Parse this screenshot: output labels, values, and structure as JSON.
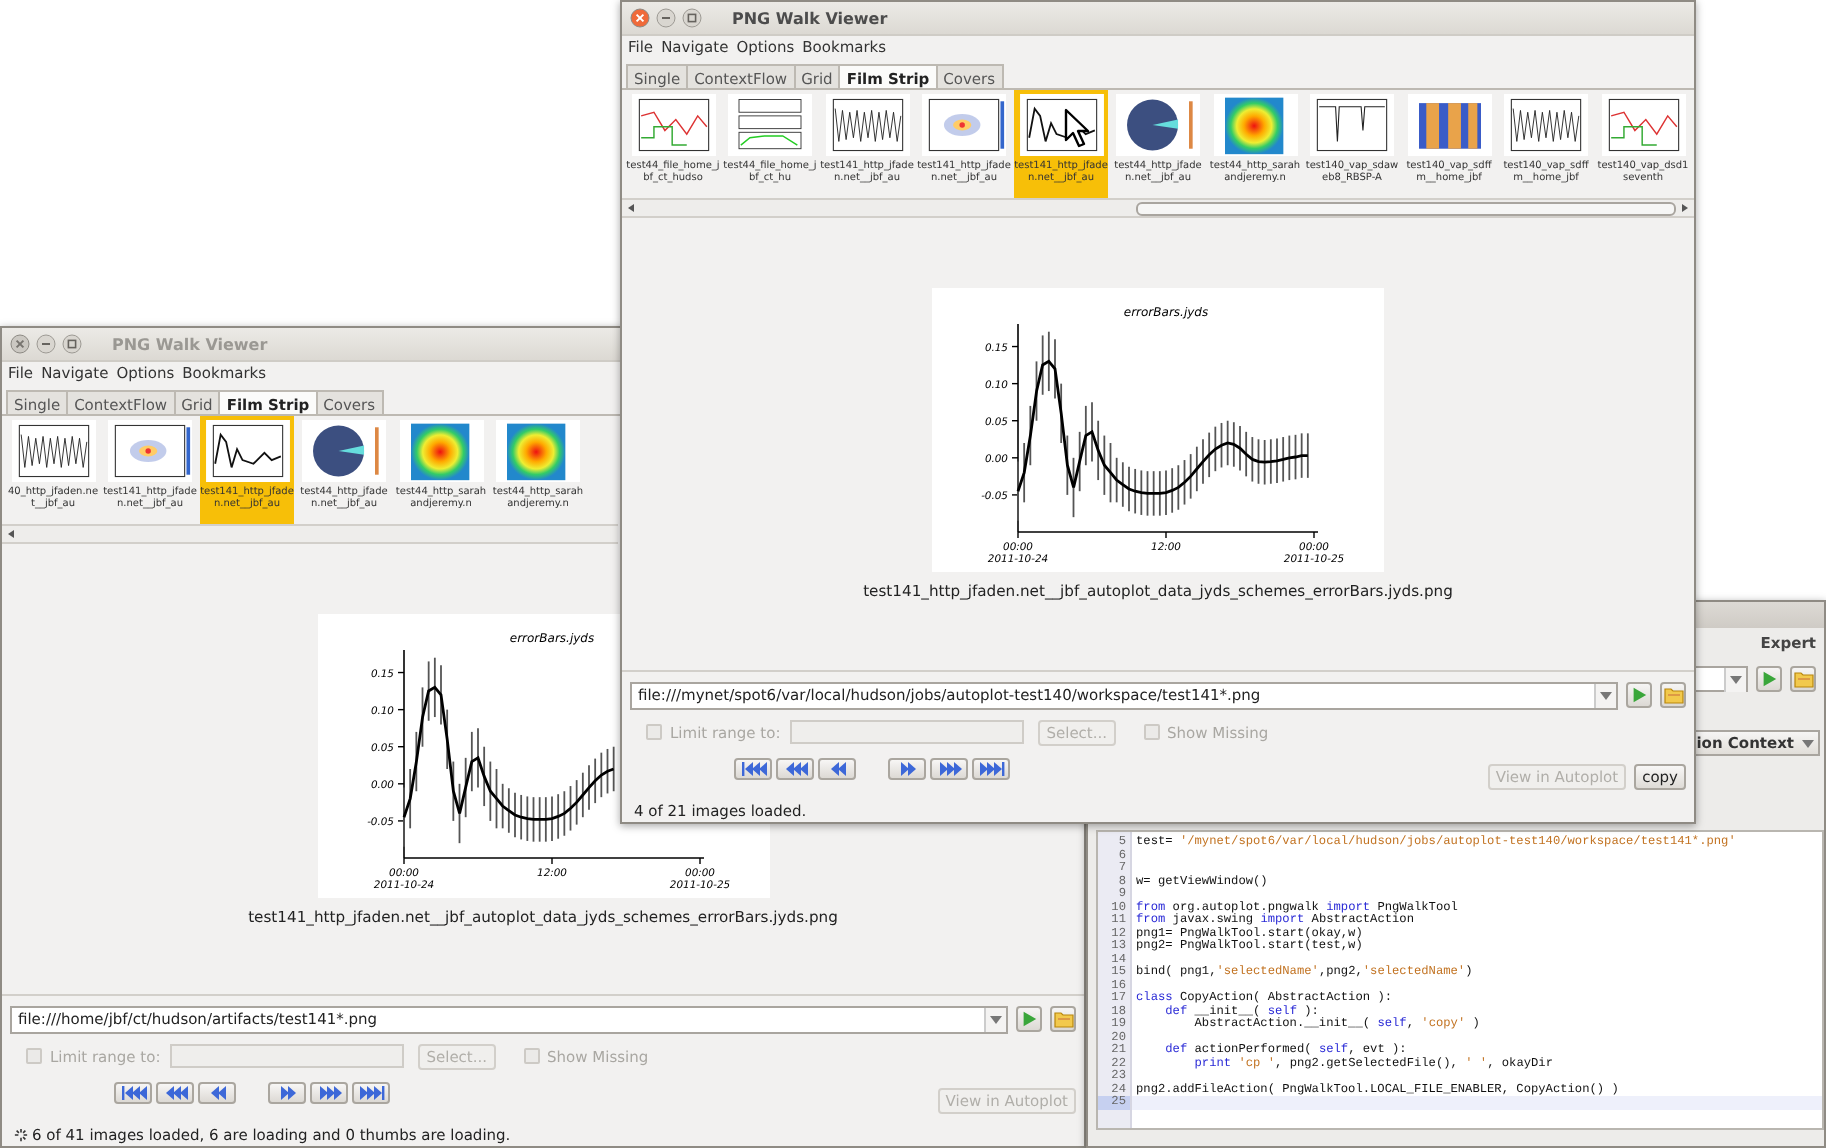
{
  "windows": [
    {
      "kind": "pngwalk",
      "active": true,
      "busy": false,
      "title": "PNG Walk Viewer",
      "menu": [
        "File",
        "Navigate",
        "Options",
        "Bookmarks"
      ],
      "tabs": [
        {
          "label": "Single",
          "selected": false
        },
        {
          "label": "ContextFlow",
          "selected": false
        },
        {
          "label": "Grid",
          "selected": false
        },
        {
          "label": "Film Strip",
          "selected": true
        },
        {
          "label": "Covers",
          "selected": false
        }
      ],
      "thumbnails": [
        {
          "kind": "lineplot",
          "caption": "test44_file_home_jbf_ct_hudso",
          "selected": false
        },
        {
          "kind": "stacked",
          "caption": "test44_file_home_jbf_ct_hu",
          "selected": false
        },
        {
          "kind": "dense",
          "caption": "test141_http_jfaden.net__jbf_au",
          "selected": false
        },
        {
          "kind": "scatter",
          "caption": "test141_http_jfaden.net__jbf_au",
          "selected": false
        },
        {
          "kind": "errorbars",
          "caption": "test141_http_jfaden.net__jbf_au",
          "selected": true
        },
        {
          "kind": "pie",
          "caption": "test44_http_jfaden.net__jbf_au",
          "selected": false
        },
        {
          "kind": "heatmap",
          "caption": "test44_http_sarahandjeremy.n",
          "selected": false
        },
        {
          "kind": "spikes",
          "caption": "test140_vap_sdaweb8_RBSP-A",
          "selected": false
        },
        {
          "kind": "spectrogram",
          "caption": "test140_vap_sdffm__home_jbf",
          "selected": false
        },
        {
          "kind": "dense",
          "caption": "test140_vap_sdffm__home_jbf",
          "selected": false
        },
        {
          "kind": "lineplot",
          "caption": "test140_vap_dsd1seventh",
          "selected": false
        }
      ],
      "preview": {
        "caption": "test141_http_jfaden.net__jbf_autoplot_data_jyds_schemes_errorBars.jyds.png",
        "date_labels": [
          {
            "text": "2011-10-24",
            "kind": "start"
          },
          {
            "text": "2011-10-25",
            "kind": "end"
          }
        ],
        "chart_data": {
          "type": "line",
          "title": "errorBars.jyds",
          "categories": [
            "00:00",
            null,
            null,
            null,
            null,
            null,
            null,
            null,
            null,
            null,
            null,
            null,
            null,
            null,
            null,
            null,
            null,
            null,
            null,
            null,
            null,
            null,
            null,
            null,
            "12:00",
            null,
            null,
            null,
            null,
            null,
            null,
            null,
            null,
            null,
            null,
            null,
            null,
            null,
            null,
            null,
            null,
            null,
            null,
            null,
            null,
            null,
            null,
            null,
            "00:00"
          ],
          "series": [
            {
              "color": "#000000",
              "values": [
                -0.045,
                -0.02,
                0.03,
                0.09,
                0.125,
                0.13,
                0.12,
                0.06,
                -0.01,
                -0.04,
                -0.005,
                0.03,
                0.035,
                0.01,
                -0.01,
                -0.02,
                -0.03,
                -0.036,
                -0.042,
                -0.045,
                -0.047,
                -0.048,
                -0.048,
                -0.048,
                -0.047,
                -0.044,
                -0.04,
                -0.033,
                -0.025,
                -0.015,
                -0.005,
                0.004,
                0.012,
                0.017,
                0.02,
                0.018,
                0.013,
                0.005,
                -0.002,
                -0.005,
                -0.006,
                -0.005,
                -0.004,
                -0.002,
                0.0,
                0.001,
                0.003,
                0.003,
                null
              ]
            }
          ],
          "ylim": [
            -0.1,
            0.175
          ],
          "yticks": [
            {
              "value": -0.05,
              "label": "-0.05"
            },
            {
              "value": 0,
              "label": "0.00"
            },
            {
              "value": 0.05,
              "label": "0.05"
            },
            {
              "value": 0.1,
              "label": "0.10"
            },
            {
              "value": 0.15,
              "label": "0.15"
            }
          ]
        }
      },
      "url": "file:///mynet/spot6/var/local/hudson/jobs/autoplot-test140/workspace/test141*.png",
      "limit_range": {
        "label": "Limit range to:",
        "checked": false,
        "disabled": true
      },
      "select_button": {
        "label": "Select...",
        "disabled": true
      },
      "show_missing": {
        "label": "Show Missing",
        "checked": false,
        "disabled": true
      },
      "nav_buttons": [
        {
          "kind": "first"
        },
        {
          "kind": "prev_page"
        },
        {
          "kind": "prev"
        },
        {
          "kind": "next"
        },
        {
          "kind": "next_page"
        },
        {
          "kind": "last"
        }
      ],
      "actions": [
        {
          "label": "View in Autoplot",
          "disabled": true
        },
        {
          "label": "copy",
          "disabled": false
        }
      ],
      "status": "4 of 21 images loaded."
    },
    {
      "kind": "pngwalk",
      "active": false,
      "busy": true,
      "title": "PNG Walk Viewer",
      "menu": [
        "File",
        "Navigate",
        "Options",
        "Bookmarks"
      ],
      "tabs": [
        {
          "label": "Single",
          "selected": false
        },
        {
          "label": "ContextFlow",
          "selected": false
        },
        {
          "label": "Grid",
          "selected": false
        },
        {
          "label": "Film Strip",
          "selected": true
        },
        {
          "label": "Covers",
          "selected": false
        }
      ],
      "thumbnails": [
        {
          "kind": "dense",
          "caption": "40_http_jfaden.net__jbf_au",
          "selected": false
        },
        {
          "kind": "scatter",
          "caption": "test141_http_jfaden.net__jbf_au",
          "selected": false
        },
        {
          "kind": "errorbars",
          "caption": "test141_http_jfaden.net__jbf_au",
          "selected": true
        },
        {
          "kind": "pie",
          "caption": "test44_http_jfaden.net__jbf_au",
          "selected": false
        },
        {
          "kind": "heatmap",
          "caption": "test44_http_sarahandjeremy.n",
          "selected": false
        },
        {
          "kind": "heatmap",
          "caption": "test44_http_sarahandjeremy.n",
          "selected": false
        }
      ],
      "preview": {
        "caption": "test141_http_jfaden.net__jbf_autoplot_data_jyds_schemes_errorBars.jyds.png",
        "date_labels": [
          {
            "text": "2011-10-24",
            "kind": "start"
          },
          {
            "text": "2011-10-25",
            "kind": "end"
          }
        ],
        "chart_data": {
          "type": "line",
          "title": "errorBars.jyds",
          "categories": [
            "00:00",
            null,
            null,
            null,
            null,
            null,
            null,
            null,
            null,
            null,
            null,
            null,
            null,
            null,
            null,
            null,
            null,
            null,
            null,
            null,
            null,
            null,
            null,
            null,
            "12:00",
            null,
            null,
            null,
            null,
            null,
            null,
            null,
            null,
            null,
            null,
            null,
            null,
            null,
            null,
            null,
            null,
            null,
            null,
            null,
            null,
            null,
            null,
            null,
            "00:00"
          ],
          "series": [
            {
              "color": "#000000",
              "values": [
                -0.045,
                -0.02,
                0.03,
                0.09,
                0.125,
                0.13,
                0.12,
                0.06,
                -0.01,
                -0.04,
                -0.005,
                0.03,
                0.035,
                0.01,
                -0.01,
                -0.02,
                -0.03,
                -0.036,
                -0.042,
                -0.045,
                -0.047,
                -0.048,
                -0.048,
                -0.048,
                -0.047,
                -0.044,
                -0.04,
                -0.033,
                -0.025,
                -0.015,
                -0.005,
                0.004,
                0.012,
                0.017,
                0.02,
                null,
                null,
                null,
                null,
                null,
                null,
                null,
                null,
                null,
                null,
                null,
                null,
                null,
                null
              ]
            }
          ],
          "ylim": [
            -0.1,
            0.175
          ],
          "yticks": [
            {
              "value": -0.05,
              "label": "-0.05"
            },
            {
              "value": 0,
              "label": "0.00"
            },
            {
              "value": 0.05,
              "label": "0.05"
            },
            {
              "value": 0.1,
              "label": "0.10"
            },
            {
              "value": 0.15,
              "label": "0.15"
            }
          ]
        }
      },
      "url": "file:///home/jbf/ct/hudson/artifacts/test141*.png",
      "limit_range": {
        "label": "Limit range to:",
        "checked": false,
        "disabled": true
      },
      "select_button": {
        "label": "Select...",
        "disabled": true
      },
      "show_missing": {
        "label": "Show Missing",
        "checked": false,
        "disabled": true
      },
      "nav_buttons": [
        {
          "kind": "first"
        },
        {
          "kind": "prev_page"
        },
        {
          "kind": "prev"
        },
        {
          "kind": "next"
        },
        {
          "kind": "next_page"
        },
        {
          "kind": "last"
        }
      ],
      "actions": [
        {
          "label": "View in Autoplot",
          "disabled": true
        }
      ],
      "status": "6 of 41 images loaded, 6 are loading and 0 thumbs are loading."
    },
    {
      "kind": "editor",
      "menu_item": "Expert",
      "context_dropdown": "ion Context",
      "code_lines": [
        {
          "number": "5",
          "current": false,
          "segments": [
            {
              "kind": "plain",
              "text": "test= "
            },
            {
              "kind": "string",
              "text": "'/mynet/spot6/var/local/hudson/jobs/autoplot-test140/workspace/test141*.png'"
            }
          ]
        },
        {
          "number": "6",
          "current": false
        },
        {
          "number": "7",
          "current": false
        },
        {
          "number": "8",
          "current": false,
          "segments": [
            {
              "kind": "plain",
              "text": "w= getViewWindow()"
            }
          ]
        },
        {
          "number": "9",
          "current": false
        },
        {
          "number": "10",
          "current": false,
          "segments": [
            {
              "kind": "keyword",
              "text": "from"
            },
            {
              "kind": "plain",
              "text": " org.autoplot.pngwalk "
            },
            {
              "kind": "keyword",
              "text": "import"
            },
            {
              "kind": "plain",
              "text": " PngWalkTool"
            }
          ]
        },
        {
          "number": "11",
          "current": false,
          "segments": [
            {
              "kind": "keyword",
              "text": "from"
            },
            {
              "kind": "plain",
              "text": " javax.swing "
            },
            {
              "kind": "keyword",
              "text": "import"
            },
            {
              "kind": "plain",
              "text": " AbstractAction"
            }
          ]
        },
        {
          "number": "12",
          "current": false,
          "segments": [
            {
              "kind": "plain",
              "text": "png1= PngWalkTool.start(okay,w)"
            }
          ]
        },
        {
          "number": "13",
          "current": false,
          "segments": [
            {
              "kind": "plain",
              "text": "png2= PngWalkTool.start(test,w)"
            }
          ]
        },
        {
          "number": "14",
          "current": false
        },
        {
          "number": "15",
          "current": false,
          "segments": [
            {
              "kind": "plain",
              "text": "bind( png1,"
            },
            {
              "kind": "string",
              "text": "'selectedName'"
            },
            {
              "kind": "plain",
              "text": ",png2,"
            },
            {
              "kind": "string",
              "text": "'selectedName'"
            },
            {
              "kind": "plain",
              "text": ")"
            }
          ]
        },
        {
          "number": "16",
          "current": false
        },
        {
          "number": "17",
          "current": false,
          "segments": [
            {
              "kind": "keyword",
              "text": "class"
            },
            {
              "kind": "plain",
              "text": " CopyAction( AbstractAction ):"
            }
          ]
        },
        {
          "number": "18",
          "current": false,
          "segments": [
            {
              "kind": "keyword",
              "text": "    def"
            },
            {
              "kind": "plain",
              "text": " __init__( "
            },
            {
              "kind": "keyword",
              "text": "self"
            },
            {
              "kind": "plain",
              "text": " ):"
            }
          ]
        },
        {
          "number": "19",
          "current": false,
          "segments": [
            {
              "kind": "plain",
              "text": "        AbstractAction.__init__( "
            },
            {
              "kind": "keyword",
              "text": "self"
            },
            {
              "kind": "plain",
              "text": ", "
            },
            {
              "kind": "string",
              "text": "'copy'"
            },
            {
              "kind": "plain",
              "text": " )"
            }
          ]
        },
        {
          "number": "20",
          "current": false
        },
        {
          "number": "21",
          "current": false,
          "segments": [
            {
              "kind": "keyword",
              "text": "    def"
            },
            {
              "kind": "plain",
              "text": " actionPerformed( "
            },
            {
              "kind": "keyword",
              "text": "self"
            },
            {
              "kind": "plain",
              "text": ", evt ):"
            }
          ]
        },
        {
          "number": "22",
          "current": false,
          "segments": [
            {
              "kind": "keyword",
              "text": "        print"
            },
            {
              "kind": "string",
              "text": " 'cp '"
            },
            {
              "kind": "plain",
              "text": ", png2.getSelectedFile(), "
            },
            {
              "kind": "string",
              "text": "' '"
            },
            {
              "kind": "plain",
              "text": ", okayDir"
            }
          ]
        },
        {
          "number": "23",
          "current": false
        },
        {
          "number": "24",
          "current": false,
          "segments": [
            {
              "kind": "plain",
              "text": "png2.addFileAction( PngWalkTool.LOCAL_FILE_ENABLER, CopyAction() )"
            }
          ]
        },
        {
          "number": "25",
          "current": true
        }
      ]
    }
  ]
}
